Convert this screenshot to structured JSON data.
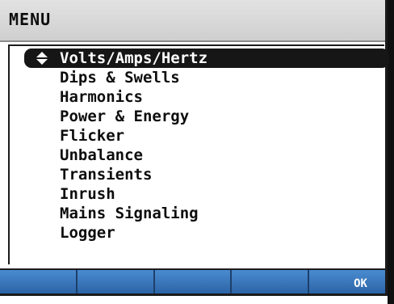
{
  "title": "MENU",
  "menu": {
    "items": [
      {
        "label": "Volts/Amps/Hertz",
        "selected": true
      },
      {
        "label": "Dips & Swells"
      },
      {
        "label": "Harmonics"
      },
      {
        "label": "Power & Energy"
      },
      {
        "label": "Flicker"
      },
      {
        "label": "Unbalance"
      },
      {
        "label": "Transients"
      },
      {
        "label": "Inrush"
      },
      {
        "label": "Mains Signaling"
      },
      {
        "label": "Logger"
      }
    ]
  },
  "softkeys": [
    "",
    "",
    "",
    "",
    "OK"
  ],
  "colors": {
    "selection_bg": "#161616",
    "softkey_blue": "#2f6fb0",
    "titlebar_gray": "#d8d8d8"
  },
  "icons": {
    "selection": "up-down-arrows-icon"
  }
}
